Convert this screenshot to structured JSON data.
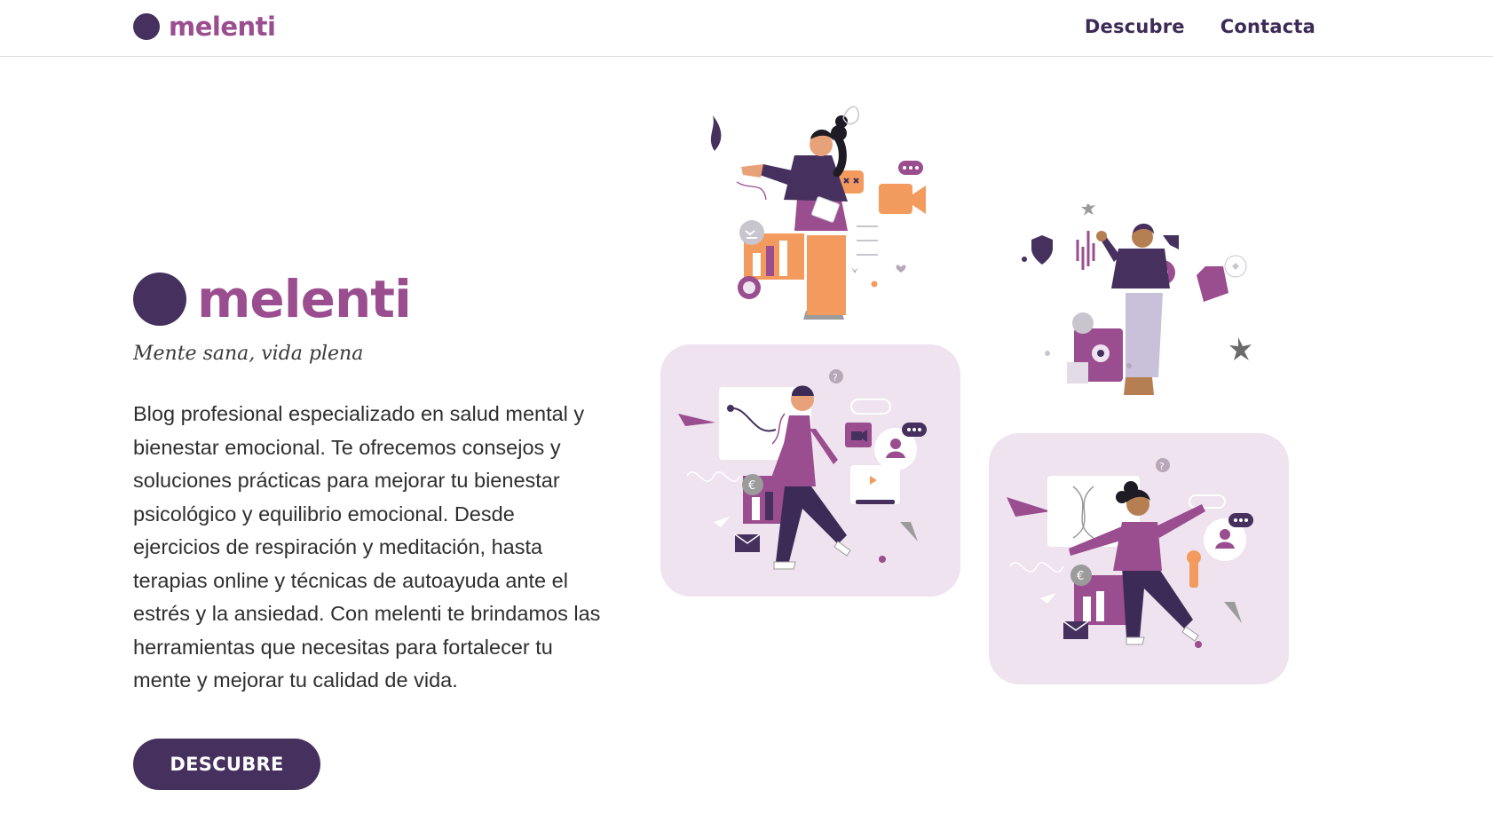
{
  "header": {
    "logo_text": "melenti",
    "nav": [
      {
        "label": "Descubre"
      },
      {
        "label": "Contacta"
      }
    ]
  },
  "hero": {
    "brand_text": "melenti",
    "tagline": "Mente sana, vida plena",
    "description": "Blog profesional especializado en salud mental y bienestar emocional. Te ofrecemos consejos y soluciones prácticas para mejorar tu bienestar psicológico y equilibrio emocional. Desde ejercicios de respiración y meditación, hasta terapias online y técnicas de autoayuda ante el estrés y la ansiedad. Con melenti te brindamos las herramientas que necesitas para fortalecer tu mente y mejorar tu calidad de vida.",
    "cta_label": "DESCUBRE"
  },
  "illustrations": [
    {
      "icon": "woman-with-chart-illustration"
    },
    {
      "icon": "person-with-safe-illustration"
    },
    {
      "icon": "man-walking-chart-illustration"
    },
    {
      "icon": "woman-dancing-dna-illustration"
    }
  ],
  "colors": {
    "brand_purple": "#45305e",
    "accent_magenta": "#9a4d8f",
    "card_bg": "#efe3ef",
    "accent_orange": "#f39b5f"
  }
}
